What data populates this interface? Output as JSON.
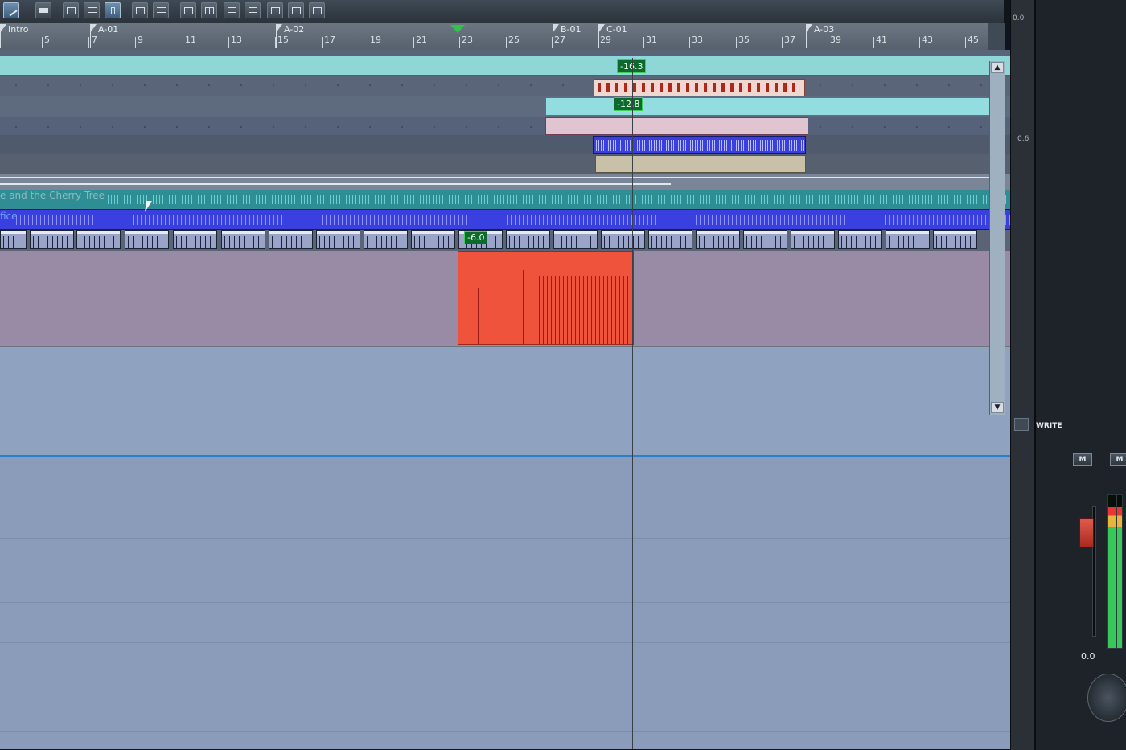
{
  "toolbar": {
    "buttons": [
      {
        "icon": "pencil-icon",
        "active": true
      },
      {
        "icon": "eraser-icon",
        "active": false
      },
      {
        "icon": "notation-icon",
        "active": false
      },
      {
        "icon": "piano-roll-icon",
        "active": false
      },
      {
        "icon": "clip-icon",
        "active": true
      },
      {
        "icon": "snap-icon",
        "active": false
      },
      {
        "icon": "list-icon",
        "active": false
      },
      {
        "icon": "view-split-icon",
        "active": false
      },
      {
        "icon": "grid-icon",
        "active": false
      },
      {
        "icon": "menu-icon",
        "active": false
      },
      {
        "icon": "lines-icon",
        "active": false
      },
      {
        "icon": "loop-icon",
        "active": false
      },
      {
        "icon": "screen-icon",
        "active": false
      },
      {
        "icon": "window-icon",
        "active": false
      }
    ]
  },
  "ruler": {
    "markers": [
      "Intro",
      "A-01",
      "A-02",
      "B-01",
      "C-01",
      "A-03"
    ],
    "bars": [
      "5",
      "7",
      "9",
      "11",
      "13",
      "15",
      "17",
      "19",
      "21",
      "23",
      "25",
      "27",
      "29",
      "31",
      "33",
      "35",
      "37",
      "39",
      "41",
      "43",
      "45"
    ]
  },
  "tracks": {
    "automation_values": [
      "-16.3",
      "-12.8",
      "-6.0"
    ],
    "clip_names": [
      "e and the Cherry Tree",
      "fice"
    ]
  },
  "inspector": {
    "top_value": "0.0",
    "mid_value": "0.6"
  },
  "mixer": {
    "write_label": "WRITE",
    "m_label": "M",
    "fader_value": "0.0",
    "meter_level_percent": 92,
    "colors": {
      "meter_green": "#36c95a",
      "meter_red": "#e33333",
      "fader_red": "#c9362e"
    }
  },
  "colors": {
    "accent_clip": "#f0533c",
    "audio_blue": "#3a3fe0",
    "lane_cyan": "#8fdde0",
    "ruler": "#66717c"
  }
}
